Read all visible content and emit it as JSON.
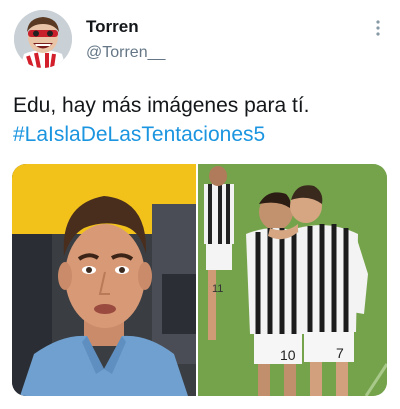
{
  "tweet": {
    "author": {
      "display_name": "Torren",
      "handle": "@Torren__",
      "avatar_icon": "cartoon-avatar-icon"
    },
    "menu_icon": "more-vertical-icon",
    "text_line": "Edu, hay más imágenes para tí.",
    "hashtag": "#LaIslaDeLasTentaciones5",
    "media": {
      "left_image": "man-shocked-face-photo",
      "right_image": "soccer-players-embrace-photo",
      "jersey_numbers": [
        "10",
        "7",
        "11"
      ]
    }
  },
  "colors": {
    "text": "#14171a",
    "secondary": "#657786",
    "hashtag": "#1b95e0",
    "background": "#ffffff"
  }
}
